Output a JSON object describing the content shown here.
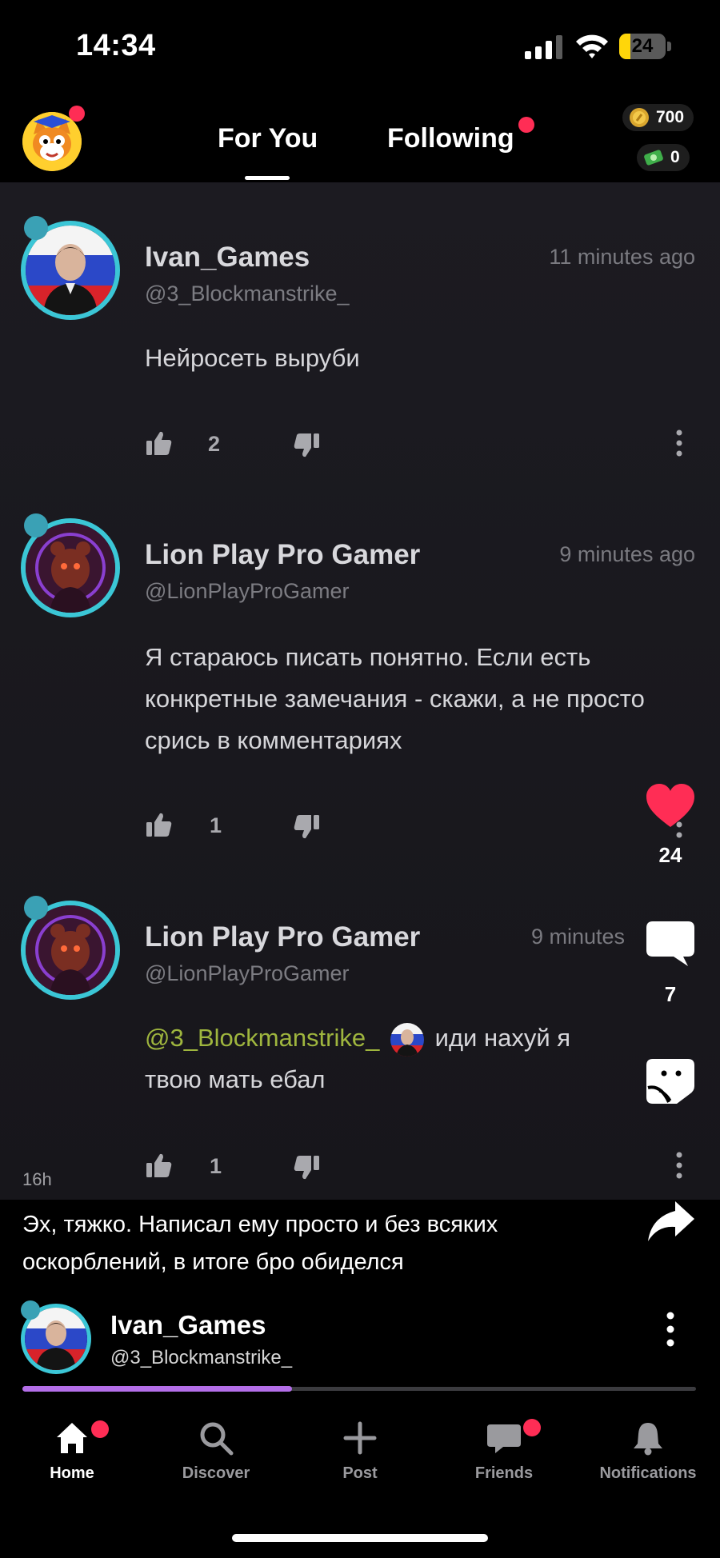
{
  "status_bar": {
    "time": "14:34",
    "battery_level": "24"
  },
  "header": {
    "tabs": [
      {
        "label": "For You",
        "active": true
      },
      {
        "label": "Following",
        "active": false
      }
    ],
    "coins": "700",
    "cash": "0"
  },
  "comments": [
    {
      "name": "Ivan_Games",
      "handle": "@3_Blockmanstrike_",
      "time": "11 minutes ago",
      "text": "Нейросеть выруби",
      "likes": "2"
    },
    {
      "name": "Lion Play Pro Gamer",
      "handle": "@LionPlayProGamer",
      "time": "9 minutes ago",
      "text": "Я стараюсь писать понятно. Если есть конкретные замечания - скажи, а не просто срись в комментариях",
      "likes": "1"
    },
    {
      "name": "Lion Play Pro Gamer",
      "handle": "@LionPlayProGamer",
      "time": "9 minutes",
      "mention": "@3_Blockmanstrike_",
      "text_after_mention": "иди нахуй я",
      "text_line2": "твою мать ебал",
      "likes": "1"
    }
  ],
  "rail": {
    "likes": "24",
    "comments": "7"
  },
  "post": {
    "age": "16h",
    "caption": "Эх, тяжко. Написал ему просто и без всяких оскорблений, в итоге бро обиделся",
    "author_name": "Ivan_Games",
    "author_handle": "@3_Blockmanstrike_",
    "progress": 0.4
  },
  "nav": [
    {
      "label": "Home",
      "icon": "home-icon",
      "active": true,
      "dot": true
    },
    {
      "label": "Discover",
      "icon": "search-icon",
      "active": false,
      "dot": false
    },
    {
      "label": "Post",
      "icon": "plus-icon",
      "active": false,
      "dot": false
    },
    {
      "label": "Friends",
      "icon": "chat-icon",
      "active": false,
      "dot": true
    },
    {
      "label": "Notifications",
      "icon": "bell-icon",
      "active": false,
      "dot": false
    }
  ],
  "colors": {
    "accent_red": "#ff2d55",
    "heart": "#ff2d55",
    "progress": "#b36ee8",
    "mention": "#9fb63e",
    "avatar_ring": "#3bc6d6"
  }
}
